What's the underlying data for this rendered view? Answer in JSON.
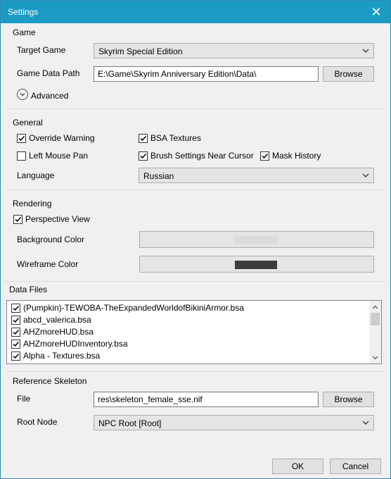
{
  "window": {
    "title": "Settings"
  },
  "game": {
    "group_title": "Game",
    "target_game_label": "Target Game",
    "target_game_value": "Skyrim Special Edition",
    "data_path_label": "Game Data Path",
    "data_path_value": "E:\\Game\\Skyrim Anniversary Edition\\Data\\",
    "browse_label": "Browse",
    "advanced_label": "Advanced"
  },
  "general": {
    "group_title": "General",
    "override_warning": "Override Warning",
    "bsa_textures": "BSA Textures",
    "left_mouse_pan": "Left Mouse Pan",
    "brush_near_cursor": "Brush Settings Near Cursor",
    "mask_history": "Mask History",
    "language_label": "Language",
    "language_value": "Russian",
    "checked": {
      "override_warning": true,
      "bsa_textures": true,
      "left_mouse_pan": false,
      "brush_near_cursor": true,
      "mask_history": true
    }
  },
  "rendering": {
    "group_title": "Rendering",
    "perspective_view": "Perspective View",
    "perspective_checked": true,
    "background_color_label": "Background Color",
    "wireframe_color_label": "Wireframe Color",
    "background_color": "#dcdcdc",
    "wireframe_color": "#3c3c3c"
  },
  "data_files": {
    "group_title": "Data Files",
    "items": [
      {
        "name": "(Pumpkin)-TEWOBA-TheExpandedWorldofBikiniArmor.bsa",
        "checked": true
      },
      {
        "name": "abcd_valerica.bsa",
        "checked": true
      },
      {
        "name": "AHZmoreHUD.bsa",
        "checked": true
      },
      {
        "name": "AHZmoreHUDInventory.bsa",
        "checked": true
      },
      {
        "name": "Alpha - Textures.bsa",
        "checked": true
      }
    ]
  },
  "reference_skeleton": {
    "group_title": "Reference Skeleton",
    "file_label": "File",
    "file_value": "res\\skeleton_female_sse.nif",
    "browse_label": "Browse",
    "root_node_label": "Root Node",
    "root_node_value": "NPC Root [Root]"
  },
  "footer": {
    "ok_label": "OK",
    "cancel_label": "Cancel"
  },
  "colors": {
    "titlebar": "#1b9bc4",
    "background": "#f0f0f0"
  }
}
